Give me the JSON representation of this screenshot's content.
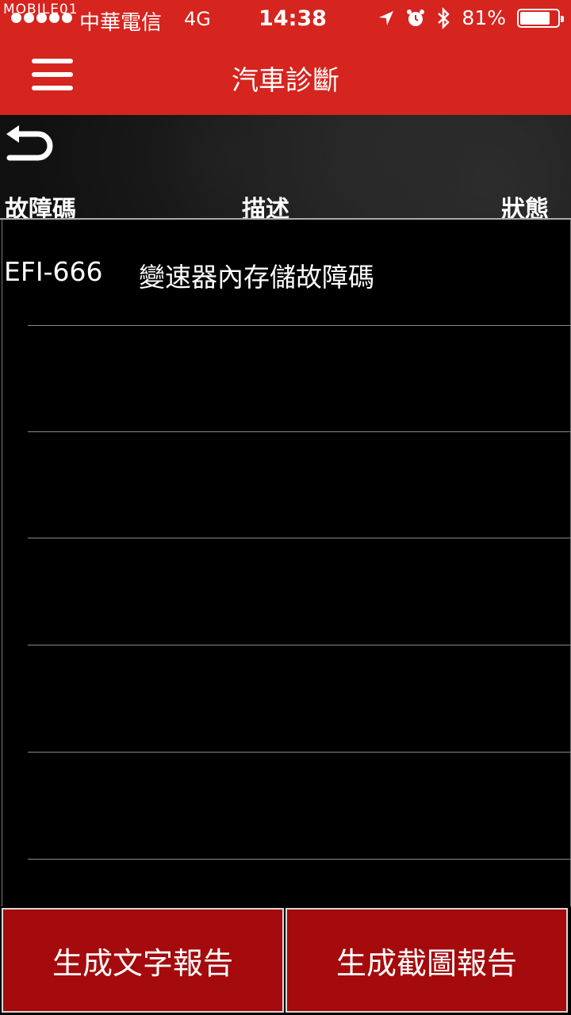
{
  "status_bar": {
    "watermark": "MOBILE01",
    "carrier": "中華電信",
    "network": "4G",
    "time": "14:38",
    "battery_percent": "81%",
    "battery_level": 0.81,
    "icons": [
      "location-arrow-icon",
      "alarm-icon",
      "bluetooth-icon",
      "battery-icon"
    ]
  },
  "nav": {
    "title": "汽車診斷"
  },
  "table": {
    "columns": {
      "code": "故障碼",
      "description": "描述",
      "status": "狀態"
    },
    "rows": [
      {
        "code": "EFI-666",
        "description": "變速器內存儲故障碼",
        "status": ""
      },
      {
        "code": "",
        "description": "",
        "status": ""
      },
      {
        "code": "",
        "description": "",
        "status": ""
      },
      {
        "code": "",
        "description": "",
        "status": ""
      },
      {
        "code": "",
        "description": "",
        "status": ""
      },
      {
        "code": "",
        "description": "",
        "status": ""
      }
    ]
  },
  "footer": {
    "text_report_label": "生成文字報告",
    "screenshot_report_label": "生成截圖報告"
  },
  "colors": {
    "brand_red": "#d6241e",
    "button_red": "#a50a0c"
  }
}
